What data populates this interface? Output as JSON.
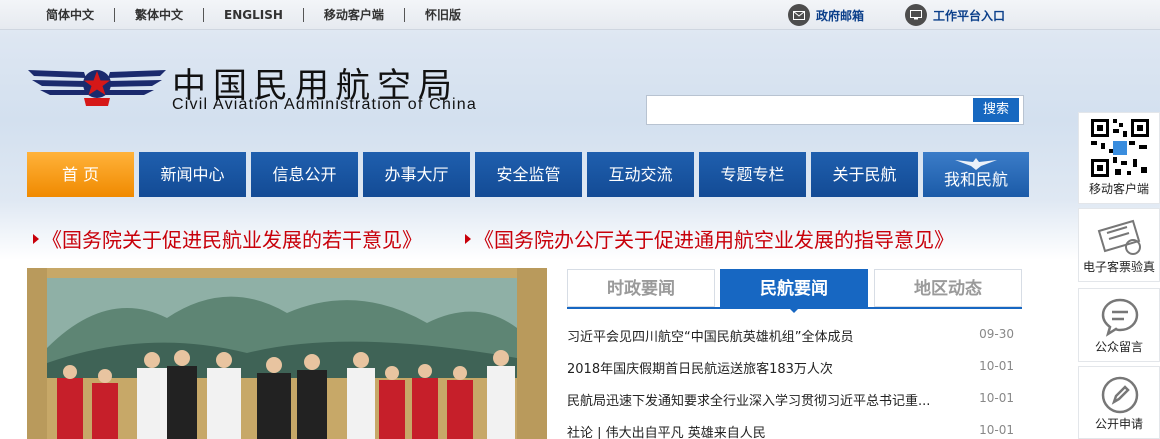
{
  "topbar": {
    "links": [
      "简体中文",
      "繁体中文",
      "ENGLISH",
      "移动客户端",
      "怀旧版"
    ],
    "mail_label": "政府邮箱",
    "mail_icon": "mail-icon",
    "workbench_label": "工作平台入口",
    "workbench_icon": "monitor-icon"
  },
  "logo": {
    "cn": "中国民用航空局",
    "en": "Civil Aviation Administration of China"
  },
  "search": {
    "placeholder": "",
    "button_label": "搜索"
  },
  "nav": {
    "items": [
      "首 页",
      "新闻中心",
      "信息公开",
      "办事大厅",
      "安全监管",
      "互动交流",
      "专题专栏",
      "关于民航",
      "我和民航"
    ]
  },
  "headlines": [
    "《国务院关于促进民航业发展的若干意见》",
    "《国务院办公厅关于促进通用航空业发展的指导意见》"
  ],
  "tabs": [
    "时政要闻",
    "民航要闻",
    "地区动态"
  ],
  "news": [
    {
      "title": "习近平会见四川航空“中国民航英雄机组”全体成员",
      "date": "09-30"
    },
    {
      "title": "2018年国庆假期首日民航运送旅客183万人次",
      "date": "10-01"
    },
    {
      "title": "民航局迅速下发通知要求全行业深入学习贯彻习近平总书记重...",
      "date": "10-01"
    },
    {
      "title": "社论 | 伟大出自平凡 英雄来自人民",
      "date": "10-01"
    }
  ],
  "side": {
    "mobile_label": "移动客户端",
    "eticket_label": "电子客票验真",
    "message_label": "公众留言",
    "apply_label": "公开申请"
  },
  "colors": {
    "nav_blue": "#1a56a3",
    "home_orange": "#f59a10",
    "headline_red": "#c8000a",
    "tab_blue": "#1767c2"
  }
}
